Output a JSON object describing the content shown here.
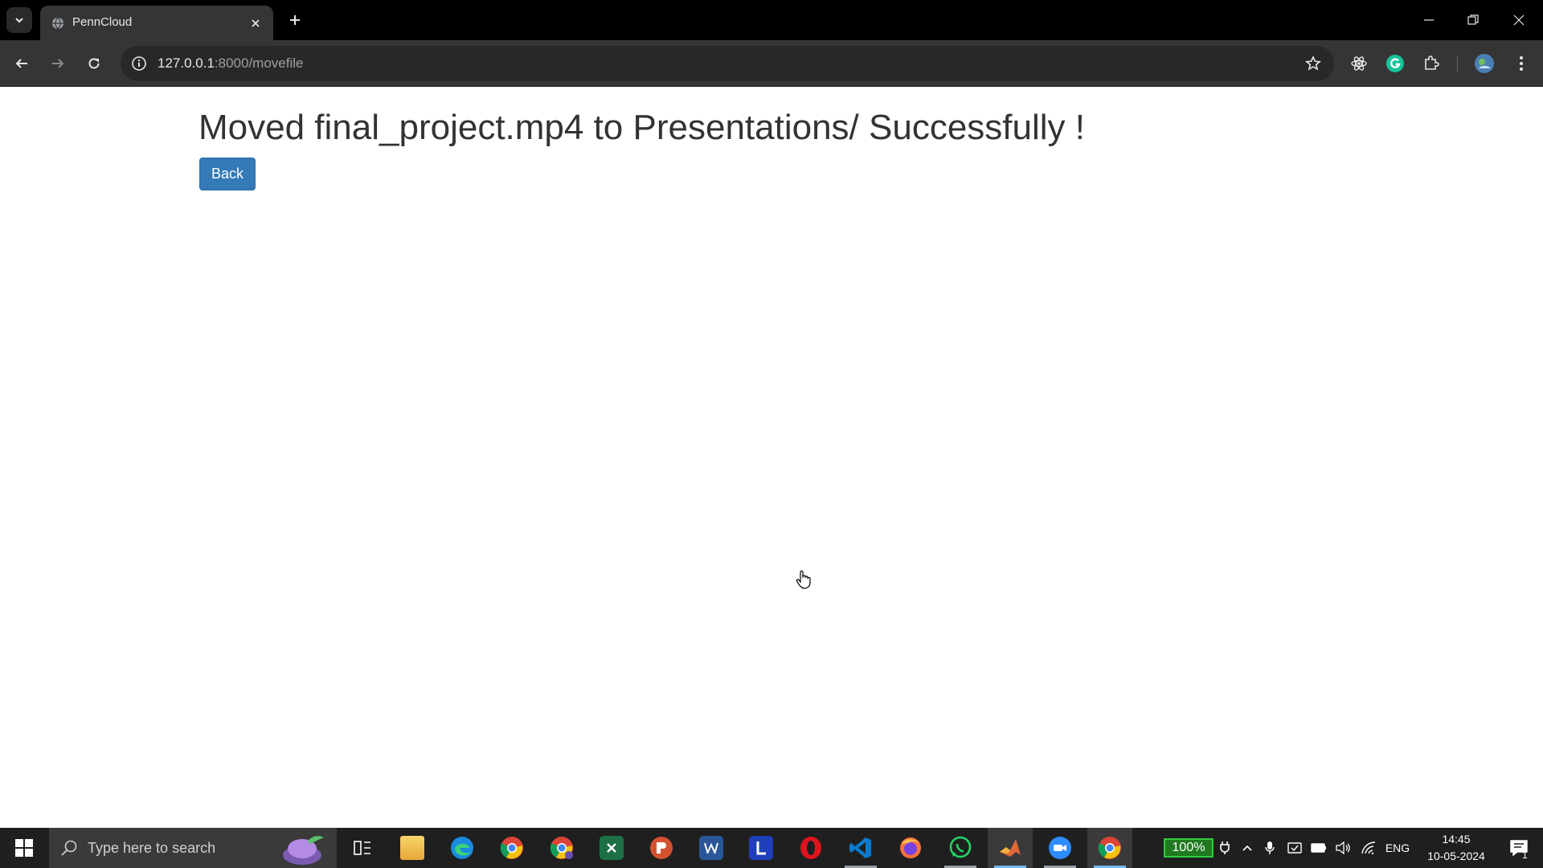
{
  "browser": {
    "tab_title": "PennCloud",
    "url_host": "127.0.0.1",
    "url_rest": ":8000/movefile"
  },
  "page": {
    "message": "Moved final_project.mp4 to Presentations/ Successfully !",
    "back_label": "Back"
  },
  "taskbar": {
    "search_placeholder": "Type here to search",
    "apps": [
      "task-view",
      "file-explorer",
      "edge",
      "chrome",
      "chrome-profile",
      "excel",
      "powerpoint",
      "word",
      "l-app",
      "opera",
      "vscode",
      "firefox",
      "whatsapp",
      "matlab",
      "zoom",
      "chrome-active"
    ],
    "battery_percent": "100%",
    "language": "ENG",
    "time": "14:45",
    "date": "10-05-2024",
    "notification_count": "1"
  },
  "colors": {
    "button": "#337ab7",
    "chrome_dark": "#353535",
    "taskbar": "#1f1f1f"
  }
}
